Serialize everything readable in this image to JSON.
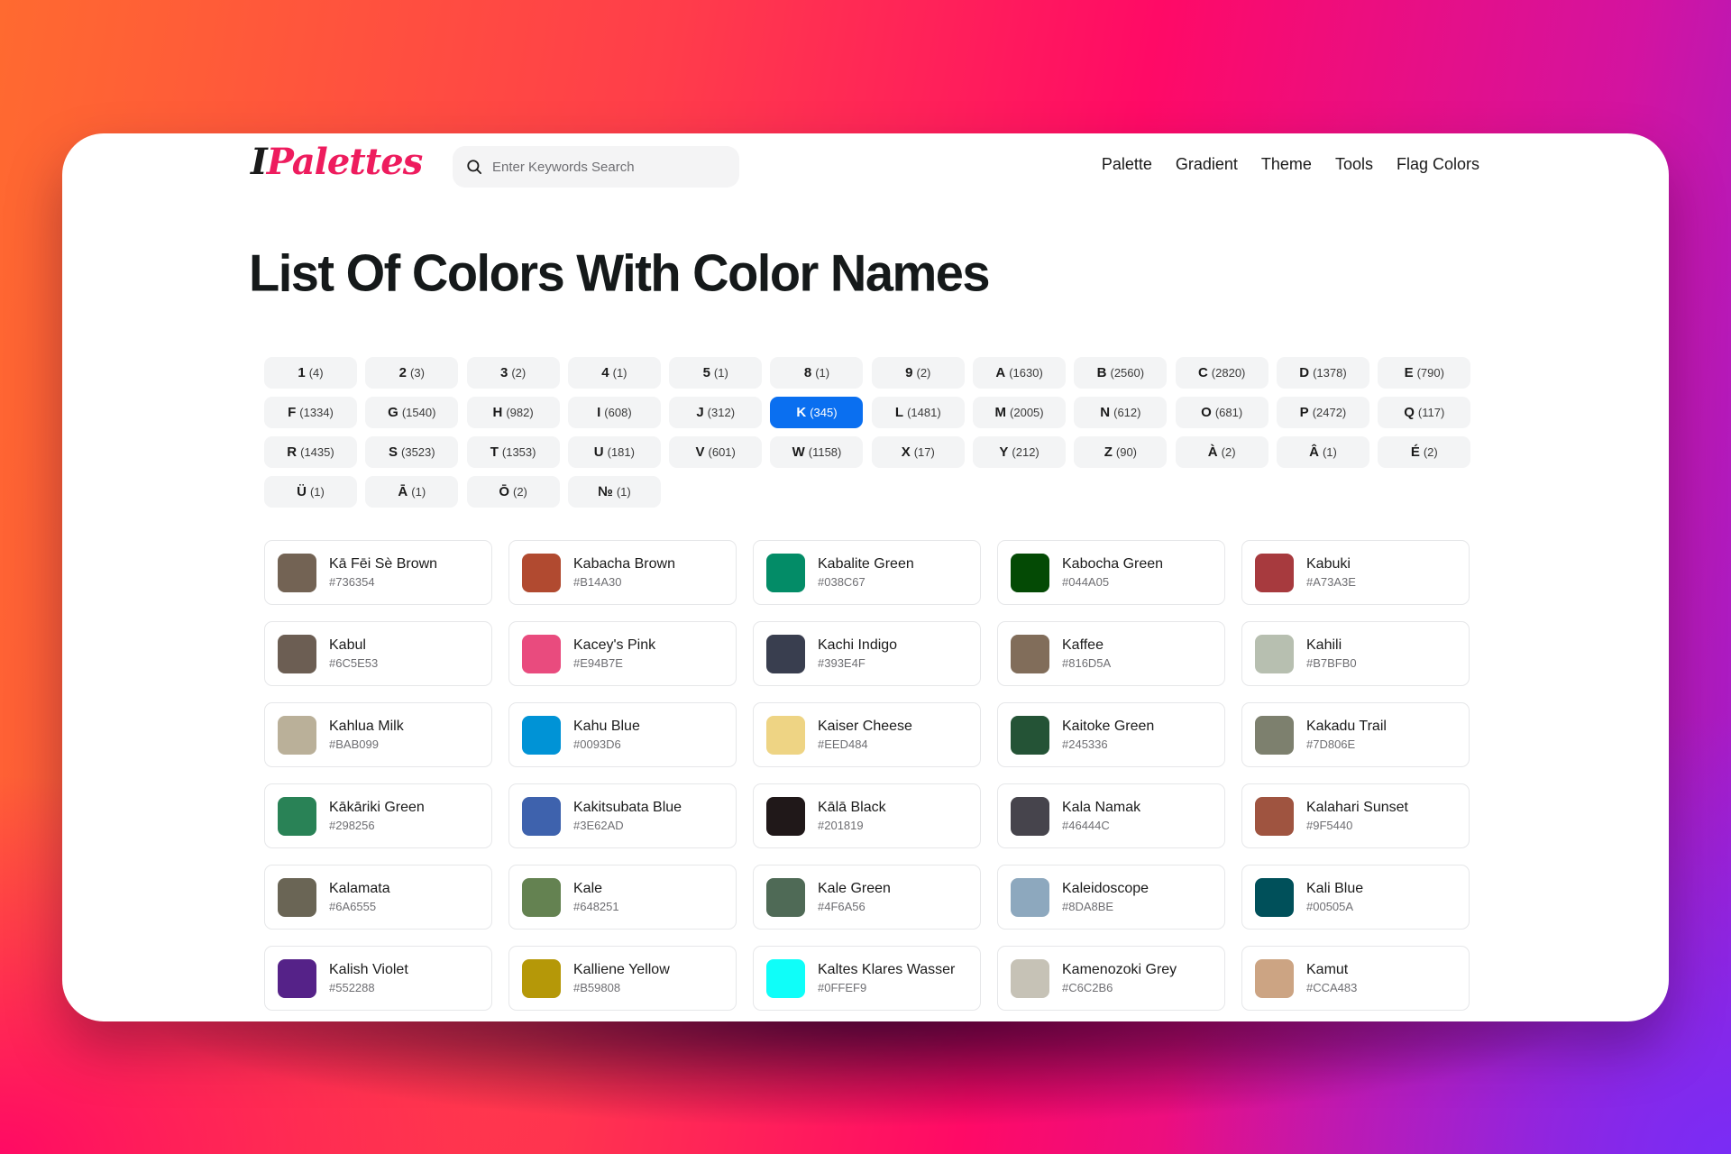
{
  "header": {
    "logo_prefix": "I",
    "logo_main": "Palettes",
    "search_placeholder": "Enter Keywords Search",
    "nav": [
      "Palette",
      "Gradient",
      "Theme",
      "Tools",
      "Flag Colors"
    ]
  },
  "page_title": "List Of Colors With Color Names",
  "accent_color": "#0A6FF0",
  "letter_filters": [
    {
      "letter": "1",
      "count": "(4)"
    },
    {
      "letter": "2",
      "count": "(3)"
    },
    {
      "letter": "3",
      "count": "(2)"
    },
    {
      "letter": "4",
      "count": "(1)"
    },
    {
      "letter": "5",
      "count": "(1)"
    },
    {
      "letter": "8",
      "count": "(1)"
    },
    {
      "letter": "9",
      "count": "(2)"
    },
    {
      "letter": "A",
      "count": "(1630)"
    },
    {
      "letter": "B",
      "count": "(2560)"
    },
    {
      "letter": "C",
      "count": "(2820)"
    },
    {
      "letter": "D",
      "count": "(1378)"
    },
    {
      "letter": "E",
      "count": "(790)"
    },
    {
      "letter": "F",
      "count": "(1334)"
    },
    {
      "letter": "G",
      "count": "(1540)"
    },
    {
      "letter": "H",
      "count": "(982)"
    },
    {
      "letter": "I",
      "count": "(608)"
    },
    {
      "letter": "J",
      "count": "(312)"
    },
    {
      "letter": "K",
      "count": "(345)",
      "active": true
    },
    {
      "letter": "L",
      "count": "(1481)"
    },
    {
      "letter": "M",
      "count": "(2005)"
    },
    {
      "letter": "N",
      "count": "(612)"
    },
    {
      "letter": "O",
      "count": "(681)"
    },
    {
      "letter": "P",
      "count": "(2472)"
    },
    {
      "letter": "Q",
      "count": "(117)"
    },
    {
      "letter": "R",
      "count": "(1435)"
    },
    {
      "letter": "S",
      "count": "(3523)"
    },
    {
      "letter": "T",
      "count": "(1353)"
    },
    {
      "letter": "U",
      "count": "(181)"
    },
    {
      "letter": "V",
      "count": "(601)"
    },
    {
      "letter": "W",
      "count": "(1158)"
    },
    {
      "letter": "X",
      "count": "(17)"
    },
    {
      "letter": "Y",
      "count": "(212)"
    },
    {
      "letter": "Z",
      "count": "(90)"
    },
    {
      "letter": "À",
      "count": "(2)"
    },
    {
      "letter": "Â",
      "count": "(1)"
    },
    {
      "letter": "É",
      "count": "(2)"
    },
    {
      "letter": "Ü",
      "count": "(1)"
    },
    {
      "letter": "Ā",
      "count": "(1)"
    },
    {
      "letter": "Ō",
      "count": "(2)"
    },
    {
      "letter": "№",
      "count": "(1)"
    }
  ],
  "colors": [
    {
      "name": "Kā Fēi Sè Brown",
      "hex": "#736354"
    },
    {
      "name": "Kabacha Brown",
      "hex": "#B14A30"
    },
    {
      "name": "Kabalite Green",
      "hex": "#038C67"
    },
    {
      "name": "Kabocha Green",
      "hex": "#044A05"
    },
    {
      "name": "Kabuki",
      "hex": "#A73A3E"
    },
    {
      "name": "Kabul",
      "hex": "#6C5E53"
    },
    {
      "name": "Kacey's Pink",
      "hex": "#E94B7E"
    },
    {
      "name": "Kachi Indigo",
      "hex": "#393E4F"
    },
    {
      "name": "Kaffee",
      "hex": "#816D5A"
    },
    {
      "name": "Kahili",
      "hex": "#B7BFB0"
    },
    {
      "name": "Kahlua Milk",
      "hex": "#BAB099"
    },
    {
      "name": "Kahu Blue",
      "hex": "#0093D6"
    },
    {
      "name": "Kaiser Cheese",
      "hex": "#EED484"
    },
    {
      "name": "Kaitoke Green",
      "hex": "#245336"
    },
    {
      "name": "Kakadu Trail",
      "hex": "#7D806E"
    },
    {
      "name": "Kākāriki Green",
      "hex": "#298256"
    },
    {
      "name": "Kakitsubata Blue",
      "hex": "#3E62AD"
    },
    {
      "name": "Kālā Black",
      "hex": "#201819"
    },
    {
      "name": "Kala Namak",
      "hex": "#46444C"
    },
    {
      "name": "Kalahari Sunset",
      "hex": "#9F5440"
    },
    {
      "name": "Kalamata",
      "hex": "#6A6555"
    },
    {
      "name": "Kale",
      "hex": "#648251"
    },
    {
      "name": "Kale Green",
      "hex": "#4F6A56"
    },
    {
      "name": "Kaleidoscope",
      "hex": "#8DA8BE"
    },
    {
      "name": "Kali Blue",
      "hex": "#00505A"
    },
    {
      "name": "Kalish Violet",
      "hex": "#552288"
    },
    {
      "name": "Kalliene Yellow",
      "hex": "#B59808"
    },
    {
      "name": "Kaltes Klares Wasser",
      "hex": "#0FFEF9"
    },
    {
      "name": "Kamenozoki Grey",
      "hex": "#C6C2B6"
    },
    {
      "name": "Kamut",
      "hex": "#CCA483"
    }
  ]
}
